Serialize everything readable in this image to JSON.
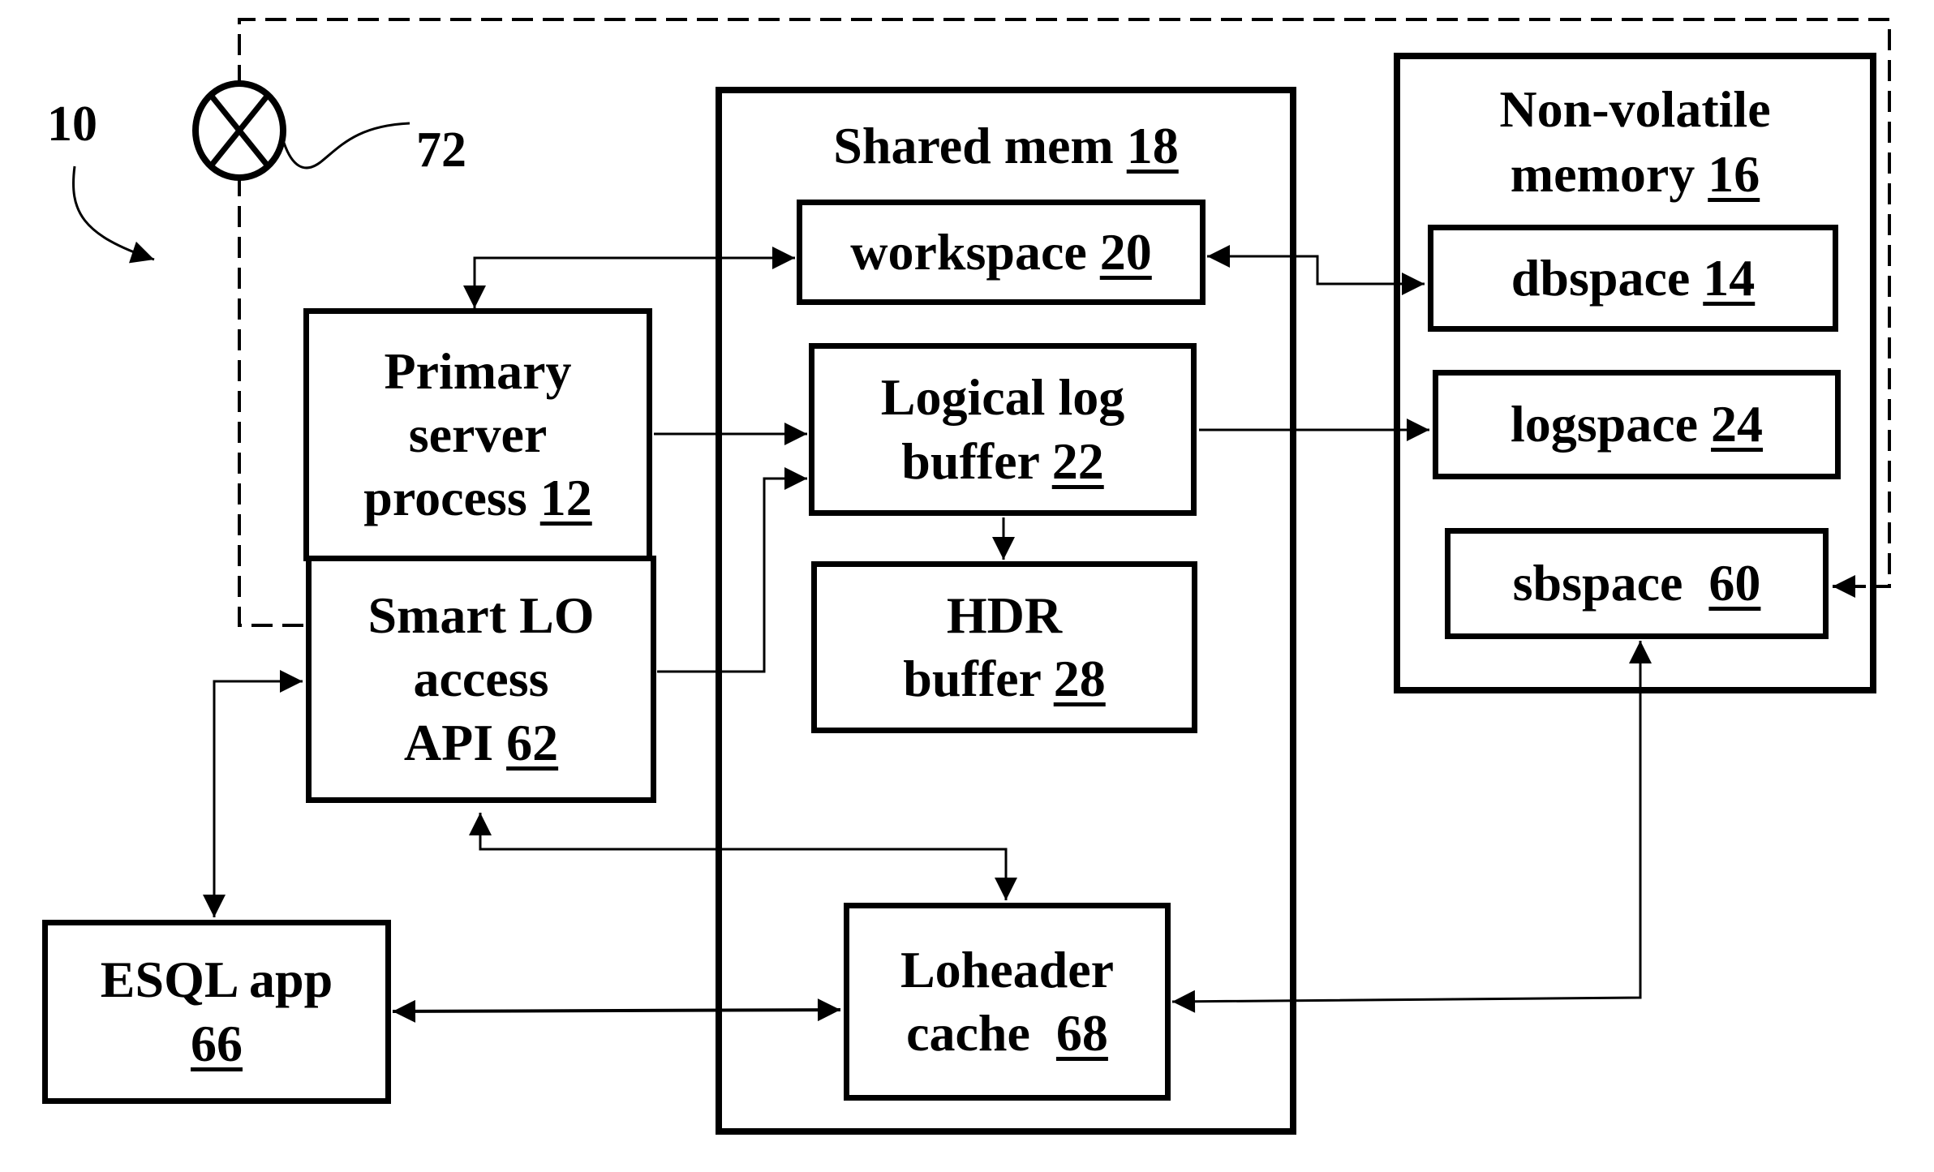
{
  "figure_ref": "10",
  "switch_ref": "72",
  "shared_memory": {
    "label": "Shared mem",
    "num": "18"
  },
  "workspace": {
    "label": "workspace",
    "num": "20"
  },
  "logical_log_buffer": {
    "line1": "Logical log",
    "line2": "buffer",
    "num": "22"
  },
  "hdr_buffer": {
    "line1": "HDR",
    "line2": "buffer",
    "num": "28"
  },
  "loheader_cache": {
    "line1": "Loheader",
    "line2": "cache",
    "num": "68"
  },
  "non_volatile_memory": {
    "line1": "Non-volatile",
    "line2": "memory",
    "num": "16"
  },
  "dbspace": {
    "label": "dbspace",
    "num": "14"
  },
  "logspace": {
    "label": "logspace",
    "num": "24"
  },
  "sbspace": {
    "label": "sbspace",
    "num": "60"
  },
  "primary_server": {
    "line1": "Primary",
    "line2": "server",
    "line3": "process",
    "num": "12"
  },
  "smart_lo_api": {
    "line1": "Smart LO",
    "line2": "access",
    "line3": "API",
    "num": "62"
  },
  "esql_app": {
    "line1": "ESQL app",
    "num": "66"
  }
}
